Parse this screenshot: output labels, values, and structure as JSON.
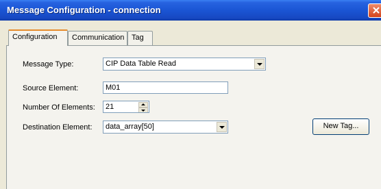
{
  "window": {
    "title": "Message Configuration - connection"
  },
  "tabs": [
    {
      "label": "Configuration",
      "active": true
    },
    {
      "label": "Communication",
      "active": false
    },
    {
      "label": "Tag",
      "active": false
    }
  ],
  "form": {
    "message_type": {
      "label": "Message Type:",
      "value": "CIP Data Table Read"
    },
    "source_element": {
      "label": "Source Element:",
      "value": "M01"
    },
    "number_of_elements": {
      "label": "Number Of Elements:",
      "value": "21"
    },
    "destination_element": {
      "label": "Destination Element:",
      "value": "data_array[50]"
    }
  },
  "buttons": {
    "new_tag": "New Tag..."
  },
  "colors": {
    "titlebar": "#1a55d4",
    "dialog_bg": "#ece9d8",
    "tab_highlight": "#e68b2c",
    "close_button": "#d3431c"
  }
}
